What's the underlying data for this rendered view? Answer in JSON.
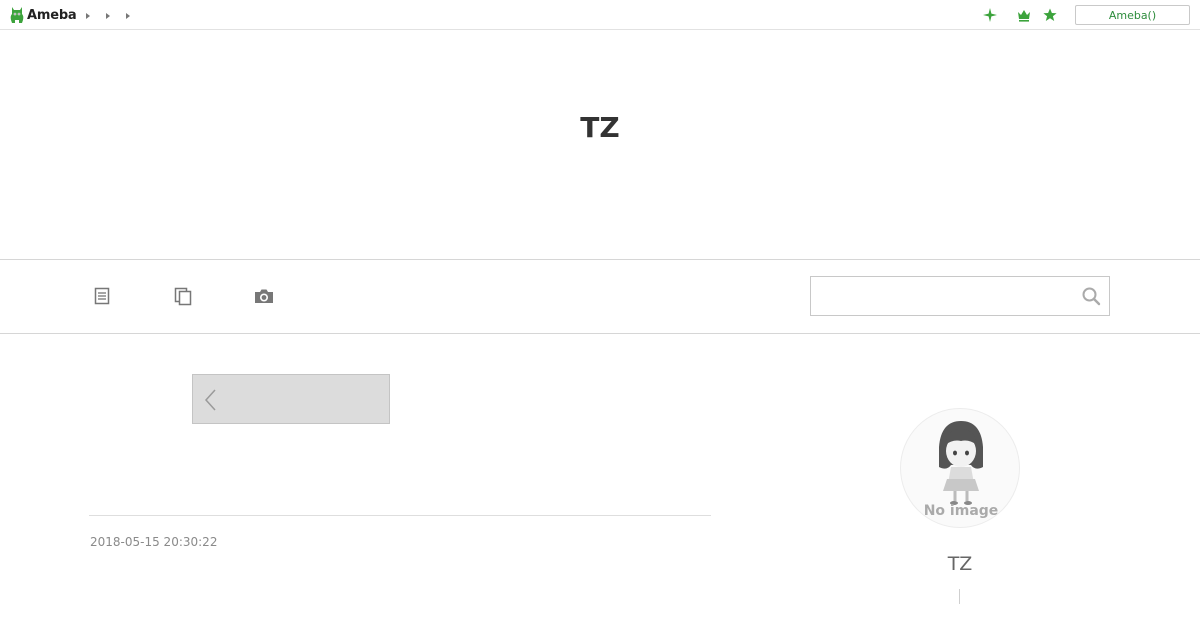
{
  "topbar": {
    "logo_text": "Ameba",
    "crumbs": [
      "",
      "",
      ""
    ],
    "icons": [
      "sparkle-icon",
      "crown-icon",
      "star-icon"
    ],
    "ameba_button_label": "Ameba()",
    "accent_color": "#3ca33c"
  },
  "blog": {
    "title": "TZ"
  },
  "nav": {
    "icons": [
      "entry-list-icon",
      "theme-list-icon",
      "camera-icon"
    ],
    "search": {
      "value": "",
      "placeholder": ""
    }
  },
  "main": {
    "post_date": "2018-05-15 20:30:22"
  },
  "sidebar": {
    "avatar_text": "No image",
    "profile_name": "TZ"
  }
}
